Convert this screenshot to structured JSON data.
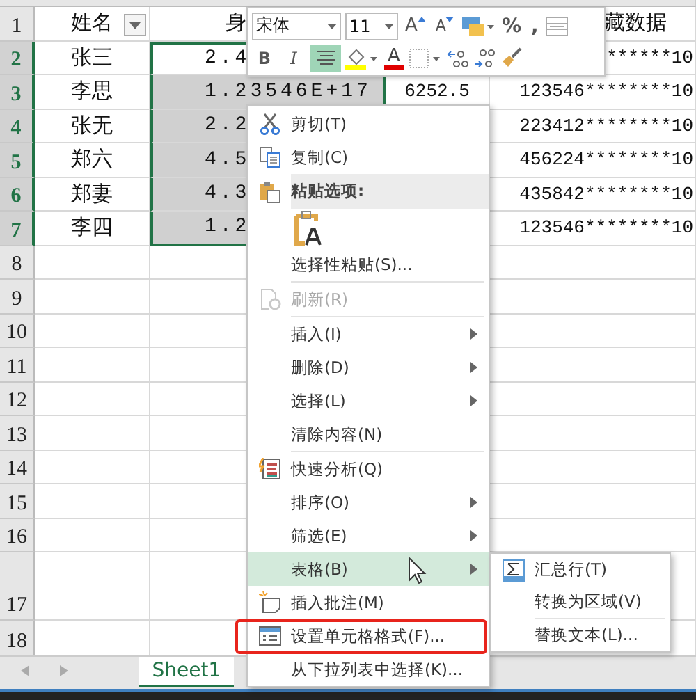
{
  "sheet": {
    "rows": [
      {
        "number": "1",
        "selected": false,
        "cells": {
          "a": {
            "text": "姓名",
            "filter": true
          },
          "b": {
            "text": "身",
            "selected": false
          },
          "d": {
            "text": "藏数据"
          }
        }
      },
      {
        "number": "2",
        "selected": true,
        "cells": {
          "a": {
            "text": "张三"
          },
          "b": {
            "text": "2.4",
            "selected": false
          },
          "d": {
            "text": "******10"
          }
        }
      },
      {
        "number": "3",
        "selected": true,
        "cells": {
          "a": {
            "text": "李思"
          },
          "b": {
            "text": "1.23546E+17",
            "selected": true
          },
          "c": {
            "text": "6252.5"
          },
          "d": {
            "text": "123546********10"
          }
        }
      },
      {
        "number": "4",
        "selected": true,
        "cells": {
          "a": {
            "text": "张无"
          },
          "b": {
            "text": "2.2",
            "selected": true
          },
          "d": {
            "text": "223412********10"
          }
        }
      },
      {
        "number": "5",
        "selected": true,
        "cells": {
          "a": {
            "text": "郑六"
          },
          "b": {
            "text": "4.5",
            "selected": true
          },
          "d": {
            "text": "456224********10"
          }
        }
      },
      {
        "number": "6",
        "selected": true,
        "cells": {
          "a": {
            "text": "郑妻"
          },
          "b": {
            "text": "4.3",
            "selected": true
          },
          "d": {
            "text": "435842********10"
          }
        }
      },
      {
        "number": "7",
        "selected": true,
        "cells": {
          "a": {
            "text": "李四"
          },
          "b": {
            "text": "1.2",
            "selected": true
          },
          "d": {
            "text": "123546********10"
          }
        }
      },
      {
        "number": "8",
        "selected": false,
        "cells": {}
      },
      {
        "number": "9",
        "selected": false,
        "cells": {}
      },
      {
        "number": "10",
        "selected": false,
        "cells": {}
      },
      {
        "number": "11",
        "selected": false,
        "cells": {}
      },
      {
        "number": "12",
        "selected": false,
        "cells": {}
      },
      {
        "number": "13",
        "selected": false,
        "cells": {}
      },
      {
        "number": "14",
        "selected": false,
        "cells": {}
      },
      {
        "number": "15",
        "selected": false,
        "cells": {}
      },
      {
        "number": "16",
        "selected": false,
        "cells": {}
      },
      {
        "number": "17",
        "selected": false,
        "cells": {}
      },
      {
        "number": "18",
        "selected": false,
        "cells": {}
      }
    ]
  },
  "mini_toolbar": {
    "font": "宋体",
    "size": "11",
    "grow_font": "A",
    "shrink_font": "A",
    "percent": "%",
    "comma": ",",
    "bold": "B",
    "italic": "I",
    "center_align_on": true,
    "font_color": "A"
  },
  "context_menu": [
    {
      "kind": "item",
      "label": "剪切(T)",
      "disabled": false,
      "submenu": false,
      "selected": false,
      "highlighted": false
    },
    {
      "kind": "item",
      "label": "复制(C)",
      "disabled": false,
      "submenu": false,
      "selected": false,
      "highlighted": false
    },
    {
      "kind": "header",
      "label": "粘贴选项:"
    },
    {
      "kind": "paste"
    },
    {
      "kind": "item",
      "label": "选择性粘贴(S)...",
      "disabled": false,
      "submenu": false,
      "selected": false,
      "highlighted": false
    },
    {
      "kind": "separator"
    },
    {
      "kind": "item",
      "label": "刷新(R)",
      "disabled": true,
      "submenu": false,
      "selected": false,
      "highlighted": false
    },
    {
      "kind": "separator"
    },
    {
      "kind": "item",
      "label": "插入(I)",
      "disabled": false,
      "submenu": true,
      "selected": false,
      "highlighted": false
    },
    {
      "kind": "item",
      "label": "删除(D)",
      "disabled": false,
      "submenu": true,
      "selected": false,
      "highlighted": false
    },
    {
      "kind": "item",
      "label": "选择(L)",
      "disabled": false,
      "submenu": true,
      "selected": false,
      "highlighted": false
    },
    {
      "kind": "item",
      "label": "清除内容(N)",
      "disabled": false,
      "submenu": false,
      "selected": false,
      "highlighted": false
    },
    {
      "kind": "separator"
    },
    {
      "kind": "item",
      "label": "快速分析(Q)",
      "disabled": false,
      "submenu": false,
      "selected": false,
      "highlighted": false
    },
    {
      "kind": "item",
      "label": "排序(O)",
      "disabled": false,
      "submenu": true,
      "selected": false,
      "highlighted": false
    },
    {
      "kind": "item",
      "label": "筛选(E)",
      "disabled": false,
      "submenu": true,
      "selected": false,
      "highlighted": false
    },
    {
      "kind": "item",
      "label": "表格(B)",
      "disabled": false,
      "submenu": true,
      "selected": true,
      "highlighted": false
    },
    {
      "kind": "item",
      "label": "插入批注(M)",
      "disabled": false,
      "submenu": false,
      "selected": false,
      "highlighted": false
    },
    {
      "kind": "item",
      "label": "设置单元格格式(F)...",
      "disabled": false,
      "submenu": false,
      "selected": false,
      "highlighted": true
    },
    {
      "kind": "item",
      "label": "从下拉列表中选择(K)...",
      "disabled": false,
      "submenu": false,
      "selected": false,
      "highlighted": false
    }
  ],
  "submenu": [
    {
      "kind": "item",
      "label": "汇总行(T)"
    },
    {
      "kind": "item",
      "label": "转换为区域(V)"
    },
    {
      "kind": "separator"
    },
    {
      "kind": "item",
      "label": "替换文本(L)..."
    }
  ],
  "sheet_tabs": [
    {
      "label": "Sheet1",
      "selected": true
    }
  ]
}
